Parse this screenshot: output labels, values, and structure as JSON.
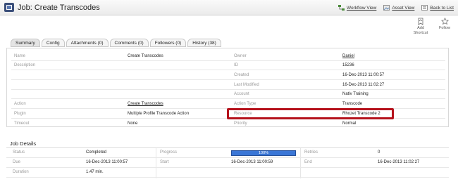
{
  "header": {
    "title": "Job: Create Transcodes",
    "links": [
      "Workflow View",
      "Asset View",
      "Back to List"
    ]
  },
  "actions": {
    "add_shortcut": "Add Shortcut",
    "follow": "Follow"
  },
  "tabs": [
    "Summary",
    "Config",
    "Attachments (0)",
    "Comments (0)",
    "Followers (0)",
    "History (38)"
  ],
  "details": {
    "name_label": "Name",
    "name": "Create Transcodes",
    "description_label": "Description",
    "action_label": "Action",
    "action": "Create Transcodes",
    "plugin_label": "Plugin",
    "plugin": "Multiple Profile Transcode Action",
    "timeout_label": "Timeout",
    "timeout": "None",
    "owner_label": "Owner",
    "owner": "Daniel",
    "id_label": "ID",
    "id": "15236",
    "created_label": "Created",
    "created": "16-Dec-2013 11:00:57",
    "modified_label": "Last Modified",
    "modified": "16-Dec-2013 11:02:27",
    "account_label": "Account",
    "account": "Nativ Training",
    "action_type_label": "Action Type",
    "action_type": "Transcode",
    "resource_label": "Resource",
    "resource": "Rhozet Transcode 2",
    "priority_label": "Priority",
    "priority": "Normal",
    "highlight_color": "#b5121b"
  },
  "job_details": {
    "title": "Job Details",
    "status_label": "Status",
    "status": "Completed",
    "progress_label": "Progress",
    "progress_text": "100%",
    "progress_fraction": 1.0,
    "retries_label": "Retries",
    "retries": "0",
    "due_label": "Due",
    "due": "16-Dec-2013 11:00:57",
    "start_label": "Start",
    "start": "16-Dec-2013 11:00:59",
    "end_label": "End",
    "end": "16-Dec-2013 11:02:27",
    "duration_label": "Duration",
    "duration": "1.47 min.",
    "progress_color": "#2f67c8"
  }
}
